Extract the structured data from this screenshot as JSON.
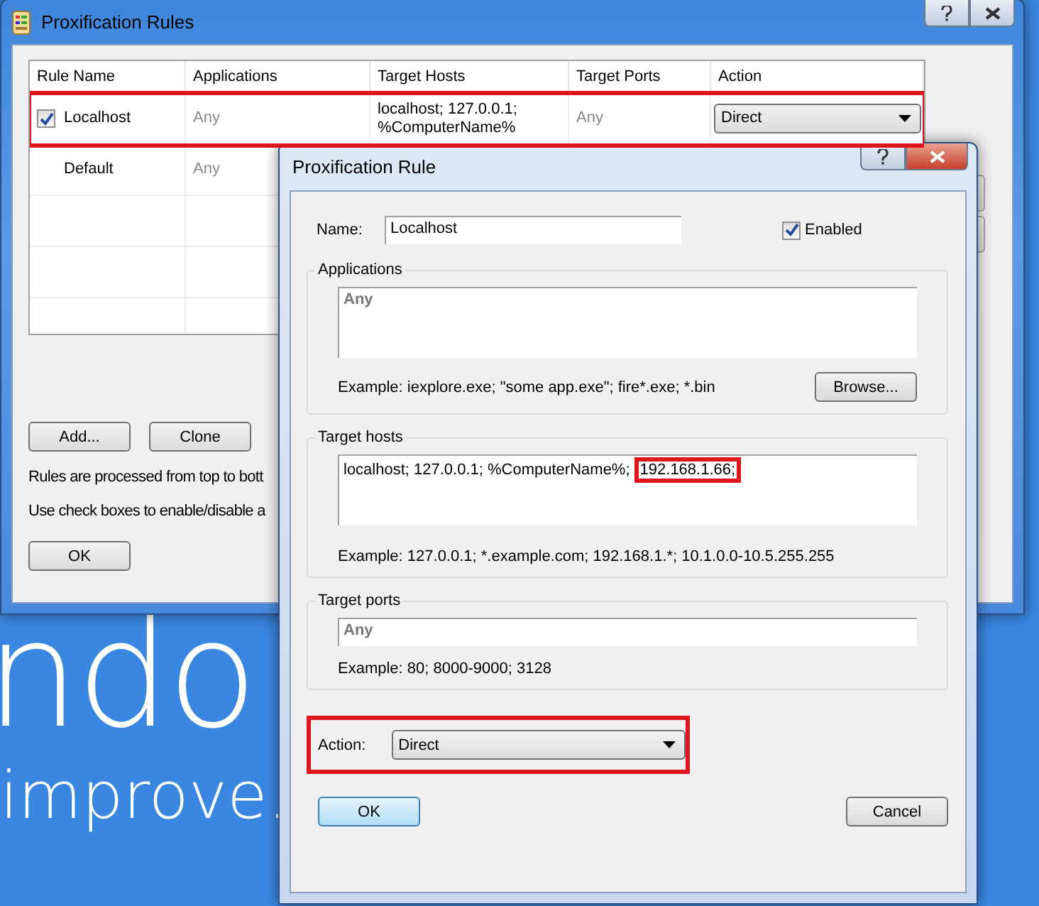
{
  "wallpaper": {
    "lines": [
      "ndo",
      "improve."
    ]
  },
  "main_window": {
    "title": "Proxification Rules",
    "table": {
      "columns": [
        "Rule Name",
        "Applications",
        "Target Hosts",
        "Target Ports",
        "Action"
      ],
      "rows": [
        {
          "kind": "custom",
          "checked": true,
          "highlighted": true,
          "name": "Localhost",
          "applications": "Any",
          "target_hosts": "localhost; 127.0.0.1; %ComputerName%",
          "target_ports": "Any",
          "action": "Direct"
        },
        {
          "kind": "default",
          "highlighted": false,
          "name": "Default",
          "applications": "Any"
        }
      ]
    },
    "buttons": [
      "Add...",
      "Clone"
    ],
    "notes": [
      "Rules are processed from top to bott",
      "Use check boxes to enable/disable a"
    ],
    "ok_button": "OK"
  },
  "dialog": {
    "title": "Proxification Rule",
    "name_label": "Name:",
    "name_value": "Localhost",
    "enabled": {
      "label": "Enabled",
      "checked": true
    },
    "applications": {
      "title": "Applications",
      "placeholder": "Any",
      "example": "Example: iexplore.exe; \"some app.exe\"; fire*.exe; *.bin",
      "browse_button": "Browse..."
    },
    "target_hosts": {
      "title": "Target hosts",
      "parts": [
        {
          "text": "localhost; 127.0.0.1; %ComputerName%;",
          "highlighted": false
        },
        {
          "text": "192.168.1.66;",
          "highlighted": true
        }
      ],
      "example": "Example: 127.0.0.1; *.example.com; 192.168.1.*; 10.1.0.0-10.5.255.255"
    },
    "target_ports": {
      "title": "Target ports",
      "placeholder": "Any",
      "example": "Example: 80; 8000-9000; 3128"
    },
    "action": {
      "label": "Action:",
      "value": "Direct",
      "highlighted": true
    },
    "ok_button": "OK",
    "cancel_button": "Cancel"
  }
}
